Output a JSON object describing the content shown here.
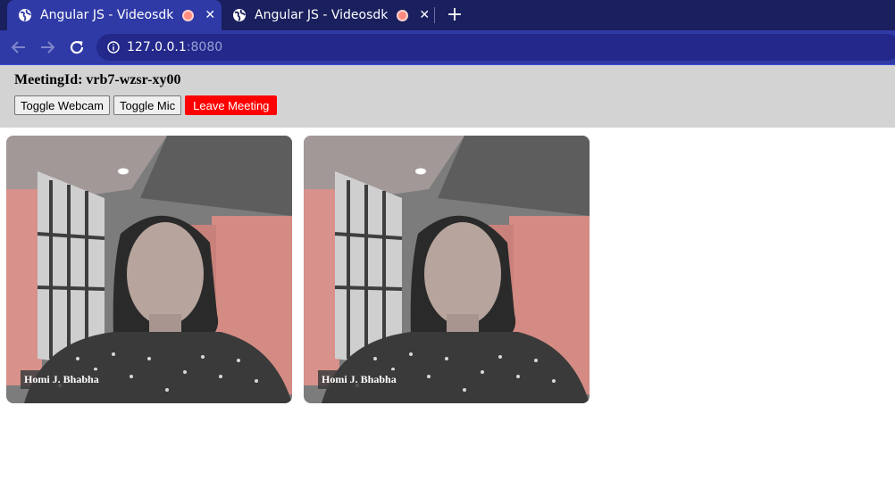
{
  "browser": {
    "tabs": [
      {
        "title": "Angular JS - Videosdk",
        "active": true
      },
      {
        "title": "Angular JS - Videosdk",
        "active": false
      }
    ],
    "address": {
      "host": "127.0.0.1",
      "port": ":8080"
    }
  },
  "meeting": {
    "label": "MeetingId: vrb7-wzsr-xy00",
    "buttons": {
      "webcam": "Toggle Webcam",
      "mic": "Toggle Mic",
      "leave": "Leave Meeting"
    }
  },
  "participants": [
    {
      "name": "Homi J. Bhabha"
    },
    {
      "name": "Homi J. Bhabha"
    }
  ],
  "colors": {
    "tabstrip": "#1a1f5e",
    "toolbar": "#2f3aa6",
    "header": "#d3d3d3",
    "leave": "#ff0000"
  }
}
